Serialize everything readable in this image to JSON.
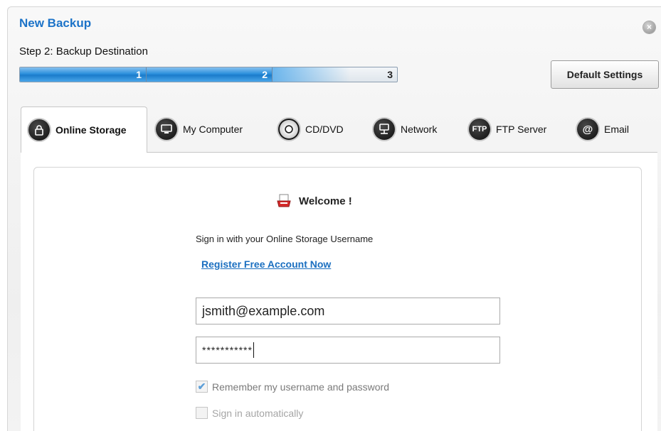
{
  "window": {
    "title": "New Backup",
    "step_label": "Step 2: Backup Destination",
    "close_glyph": "×"
  },
  "progress": {
    "steps": [
      "1",
      "2",
      "3"
    ],
    "current_step": 2,
    "fill_fraction": 0.67
  },
  "buttons": {
    "default_settings": "Default Settings"
  },
  "tabs": [
    {
      "label": "Online Storage",
      "icon": "lock-icon",
      "active": true
    },
    {
      "label": "My Computer",
      "icon": "monitor-icon",
      "active": false
    },
    {
      "label": "CD/DVD",
      "icon": "disc-icon",
      "active": false
    },
    {
      "label": "Network",
      "icon": "network-icon",
      "active": false
    },
    {
      "label": "FTP Server",
      "icon": "ftp-icon",
      "glyph": "FTP",
      "active": false
    },
    {
      "label": "Email",
      "icon": "email-icon",
      "glyph": "@",
      "active": false
    }
  ],
  "login": {
    "welcome": "Welcome !",
    "instruction": "Sign in with your Online Storage Username",
    "register_link": "Register Free Account Now",
    "username_value": "jsmith@example.com",
    "password_value": "***********",
    "remember_label": "Remember my username and password",
    "remember_checked": true,
    "auto_signin_label": "Sign in automatically",
    "auto_signin_checked": false
  },
  "colors": {
    "title": "#1c73c8",
    "link": "#1b6fc0",
    "progress": "#2b8fdc"
  }
}
